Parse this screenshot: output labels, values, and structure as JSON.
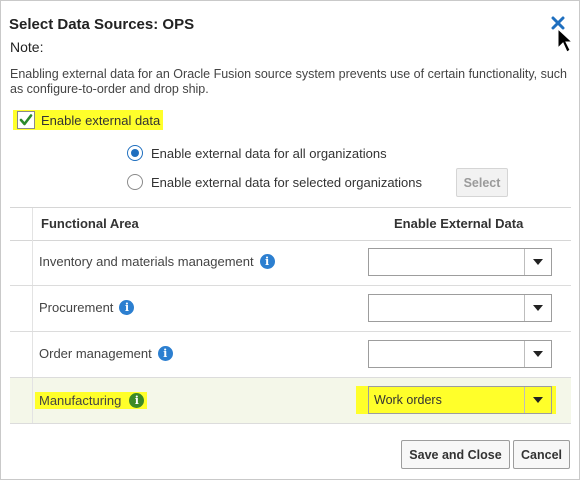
{
  "dialog": {
    "title": "Select Data Sources: OPS",
    "note_label": "Note:",
    "note_text": "Enabling external data for an Oracle Fusion source system prevents use of certain functionality, such as configure-to-order and drop ship."
  },
  "enable_external": {
    "label": "Enable external data",
    "checked": true
  },
  "scope": {
    "options": [
      {
        "label": "Enable external data for all organizations",
        "selected": true
      },
      {
        "label": "Enable external data for selected organizations",
        "selected": false
      }
    ],
    "select_button": "Select"
  },
  "table": {
    "headers": {
      "area": "Functional Area",
      "enable": "Enable External Data"
    },
    "rows": [
      {
        "area": "Inventory and materials management",
        "value": ""
      },
      {
        "area": "Procurement",
        "value": ""
      },
      {
        "area": "Order management",
        "value": ""
      },
      {
        "area": "Manufacturing",
        "value": "Work orders"
      }
    ]
  },
  "footer": {
    "save_close": "Save and Close",
    "cancel": "Cancel"
  },
  "colors": {
    "highlight": "#ffff2a",
    "accent": "#1f6fbf",
    "info": "#2c7fd0",
    "info_selected": "#3c8a27"
  },
  "icons": {
    "close": "close-icon",
    "info": "info-icon",
    "dropdown": "chevron-down-icon"
  }
}
